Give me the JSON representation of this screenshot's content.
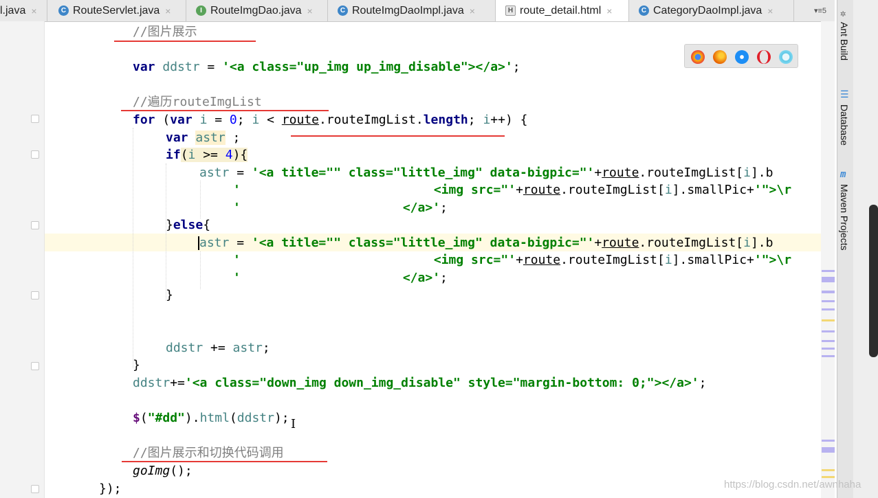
{
  "tabs": [
    {
      "label": "l.java",
      "icon": "none",
      "close": "×"
    },
    {
      "label": "RouteServlet.java",
      "icon": "C",
      "close": "×"
    },
    {
      "label": "RouteImgDao.java",
      "icon": "I",
      "close": "×"
    },
    {
      "label": "RouteImgDaoImpl.java",
      "icon": "C",
      "close": "×"
    },
    {
      "label": "route_detail.html",
      "icon": "H",
      "close": "×",
      "active": true
    },
    {
      "label": "CategoryDaoImpl.java",
      "icon": "C",
      "close": "×"
    }
  ],
  "tab_overflow": "▾≡5",
  "code": {
    "c1": "//图片展示",
    "l2_kw": "var",
    "l2_var": "ddstr",
    "l2_eq": " = ",
    "l2_str": "'<a class=\"up_img up_img_disable\"></a>'",
    "l2_end": ";",
    "c2": "//遍历routeImgList",
    "l4_for": "for",
    "l4_a": " (",
    "l4_var": "var",
    "l4_b": " ",
    "l4_i": "i",
    "l4_c": " = ",
    "l4_zero": "0",
    "l4_d": "; ",
    "l4_i2": "i",
    "l4_e": " < ",
    "l4_route": "route",
    "l4_f": ".routeImgList.",
    "l4_len": "length",
    "l4_g": "; ",
    "l4_i3": "i",
    "l4_h": "++) {",
    "l5_kw": "var",
    "l5_var": "astr",
    "l5_end": " ;",
    "l6_if": "if",
    "l6_a": "(",
    "l6_i": "i",
    "l6_b": " >= ",
    "l6_n": "4",
    "l6_c": "){",
    "l7_var": "astr",
    "l7_a": " = ",
    "l7_str": "'<a title=\"\" class=\"little_img\" data-bigpic=\"'",
    "l7_b": "+",
    "l7_route": "route",
    "l7_c": ".routeImgList[",
    "l7_i": "i",
    "l7_d": "].b",
    "l8_q": "'",
    "l8_str": "<img src=\"'",
    "l8_a": "+",
    "l8_route": "route",
    "l8_b": ".routeImgList[",
    "l8_i": "i",
    "l8_c": "].smallPic+",
    "l8_str2": "'\">\\r",
    "l9_q": "'",
    "l9_str": "</a>'",
    "l9_end": ";",
    "l10_a": "}",
    "l10_else": "else",
    "l10_b": "{",
    "l11_var": "astr",
    "l11_a": " = ",
    "l11_str": "'<a title=\"\" class=\"little_img\" data-bigpic=\"'",
    "l11_b": "+",
    "l11_route": "route",
    "l11_c": ".routeImgList[",
    "l11_i": "i",
    "l11_d": "].b",
    "l12_q": "'",
    "l12_str": "<img src=\"'",
    "l12_a": "+",
    "l12_route": "route",
    "l12_b": ".routeImgList[",
    "l12_i": "i",
    "l12_c": "].smallPic+",
    "l12_str2": "'\">\\r",
    "l13_q": "'",
    "l13_str": "</a>'",
    "l13_end": ";",
    "l14": "}",
    "l15_var": "ddstr",
    "l15_a": " += ",
    "l15_var2": "astr",
    "l15_end": ";",
    "l16": "}",
    "l17_var": "ddstr",
    "l17_a": "+=",
    "l17_str": "'<a class=\"down_img down_img_disable\" style=\"margin-bottom: 0;\"></a>'",
    "l17_end": ";",
    "l18_dollar": "$",
    "l18_a": "(",
    "l18_str": "\"#dd\"",
    "l18_b": ").",
    "l18_fn": "html",
    "l18_c": "(",
    "l18_var": "ddstr",
    "l18_d": ");",
    "c3": "//图片展示和切换代码调用",
    "l20_fn": "goImg",
    "l20_end": "();",
    "l21": "});"
  },
  "tool_windows": [
    "Ant Build",
    "Database",
    "Maven Projects"
  ],
  "watermark": "https://blog.csdn.net/awnhaha",
  "browsers": [
    "chrome-icon",
    "firefox-icon",
    "safari-icon",
    "opera-icon",
    "ie-icon"
  ],
  "colors": {
    "keyword": "#000080",
    "string": "#008000",
    "variable": "#458383",
    "comment": "#808080",
    "number": "#0000ff",
    "underline_red": "#e53935",
    "caret_line": "#fffae3"
  }
}
